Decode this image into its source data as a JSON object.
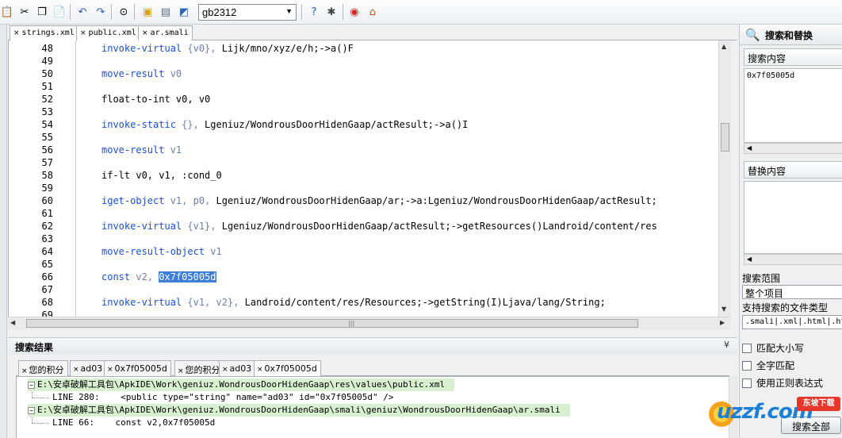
{
  "toolbar": {
    "encoding_value": "gb2312",
    "encoding_arrow": "▼",
    "icons": [
      "paste-doc-icon",
      "cut-icon",
      "copy-icon",
      "paste-icon",
      "undo-icon",
      "redo-icon",
      "binoculars-icon",
      "open-folder-icon",
      "build-icon",
      "android-apk-icon",
      "help-icon",
      "debug-bug-icon",
      "weibo-icon",
      "home-icon"
    ]
  },
  "editor_tabs": [
    {
      "close": "×",
      "label": "strings.xml"
    },
    {
      "close": "×",
      "label": "public.xml"
    },
    {
      "close": "×",
      "label": "ar.smali"
    }
  ],
  "code_lines": [
    {
      "num": "48",
      "pre": "",
      "kw": "invoke-virtual",
      "mid": " {v0}, ",
      "rest": "Lijk/mno/xyz/e/h;->a()F",
      "hl": ""
    },
    {
      "num": "49",
      "pre": "",
      "kw": "",
      "mid": "",
      "rest": "",
      "hl": ""
    },
    {
      "num": "50",
      "pre": "",
      "kw": "move-result",
      "mid": " v0",
      "rest": "",
      "hl": ""
    },
    {
      "num": "51",
      "pre": "",
      "kw": "",
      "mid": "",
      "rest": "",
      "hl": ""
    },
    {
      "num": "52",
      "pre": "",
      "kw": "",
      "mid": "",
      "rest": "float-to-int v0, v0",
      "hl": ""
    },
    {
      "num": "53",
      "pre": "",
      "kw": "",
      "mid": "",
      "rest": "",
      "hl": ""
    },
    {
      "num": "54",
      "pre": "",
      "kw": "invoke-static",
      "mid": " {}, ",
      "rest": "Lgeniuz/WondrousDoorHidenGaap/actResult;->a()I",
      "hl": ""
    },
    {
      "num": "55",
      "pre": "",
      "kw": "",
      "mid": "",
      "rest": "",
      "hl": ""
    },
    {
      "num": "56",
      "pre": "",
      "kw": "move-result",
      "mid": " v1",
      "rest": "",
      "hl": ""
    },
    {
      "num": "57",
      "pre": "",
      "kw": "",
      "mid": "",
      "rest": "",
      "hl": ""
    },
    {
      "num": "58",
      "pre": "",
      "kw": "",
      "mid": "",
      "rest": "if-lt v0, v1, :cond_0",
      "hl": ""
    },
    {
      "num": "59",
      "pre": "",
      "kw": "",
      "mid": "",
      "rest": "",
      "hl": ""
    },
    {
      "num": "60",
      "pre": "",
      "kw": "iget-object",
      "mid": " v1, p0, ",
      "rest": "Lgeniuz/WondrousDoorHidenGaap/ar;->a:Lgeniuz/WondrousDoorHidenGaap/actResult;",
      "hl": ""
    },
    {
      "num": "61",
      "pre": "",
      "kw": "",
      "mid": "",
      "rest": "",
      "hl": ""
    },
    {
      "num": "62",
      "pre": "",
      "kw": "invoke-virtual",
      "mid": " {v1}, ",
      "rest": "Lgeniuz/WondrousDoorHidenGaap/actResult;->getResources()Landroid/content/res",
      "hl": ""
    },
    {
      "num": "63",
      "pre": "",
      "kw": "",
      "mid": "",
      "rest": "",
      "hl": ""
    },
    {
      "num": "64",
      "pre": "",
      "kw": "move-result-object",
      "mid": " v1",
      "rest": "",
      "hl": ""
    },
    {
      "num": "65",
      "pre": "",
      "kw": "",
      "mid": "",
      "rest": "",
      "hl": ""
    },
    {
      "num": "66",
      "pre": "",
      "kw": "const",
      "mid": " v2, ",
      "rest": "",
      "hl": "0x7f05005d"
    },
    {
      "num": "67",
      "pre": "",
      "kw": "",
      "mid": "",
      "rest": "",
      "hl": ""
    },
    {
      "num": "68",
      "pre": "",
      "kw": "invoke-virtual",
      "mid": " {v1, v2}, ",
      "rest": "Landroid/content/res/Resources;->getString(I)Ljava/lang/String;",
      "hl": ""
    },
    {
      "num": "69",
      "pre": "",
      "kw": "",
      "mid": "",
      "rest": "",
      "hl": ""
    }
  ],
  "results": {
    "title": "搜索结果",
    "collapse": "¥",
    "tabs": [
      {
        "close": "×",
        "label": "您的积分"
      },
      {
        "close": "×",
        "label": "ad03"
      },
      {
        "close": "×",
        "label": "0x7f05005d"
      },
      {
        "close": "×",
        "label": "您的积分"
      },
      {
        "close": "×",
        "label": "ad03"
      },
      {
        "close": "×",
        "label": "0x7f05005d"
      }
    ],
    "rows": [
      {
        "exp": "−",
        "text": "E:\\安卓破解工具包\\ApkIDE\\Work\\geniuz.WondrousDoorHidenGaap\\res\\values\\public.xml"
      },
      {
        "exp": "",
        "text": "LINE 280:    <public type=\"string\" name=\"ad03\" id=\"0x7f05005d\" />"
      },
      {
        "exp": "−",
        "text": "E:\\安卓破解工具包\\ApkIDE\\Work\\geniuz.WondrousDoorHidenGaap\\smali\\geniuz\\WondrousDoorHidenGaap\\ar.smali"
      },
      {
        "exp": "",
        "text": "LINE 66:    const v2,0x7f05005d"
      }
    ]
  },
  "right_panel": {
    "title": "搜索和替换",
    "search_label": "搜索内容",
    "search_value": "0x7f05005d",
    "replace_label": "替换内容",
    "replace_value": "",
    "scope_label": "搜索范围",
    "scope_value": "整个项目",
    "filetypes_label": "支持搜索的文件类型",
    "filetypes_value": ".smali|.xml|.html|.ht",
    "checks": [
      "匹配大小写",
      "全字匹配",
      "使用正则表达式"
    ],
    "search_button": "搜索全部"
  },
  "watermark": {
    "text": "uzzf.com",
    "badge": "东坡下载"
  }
}
